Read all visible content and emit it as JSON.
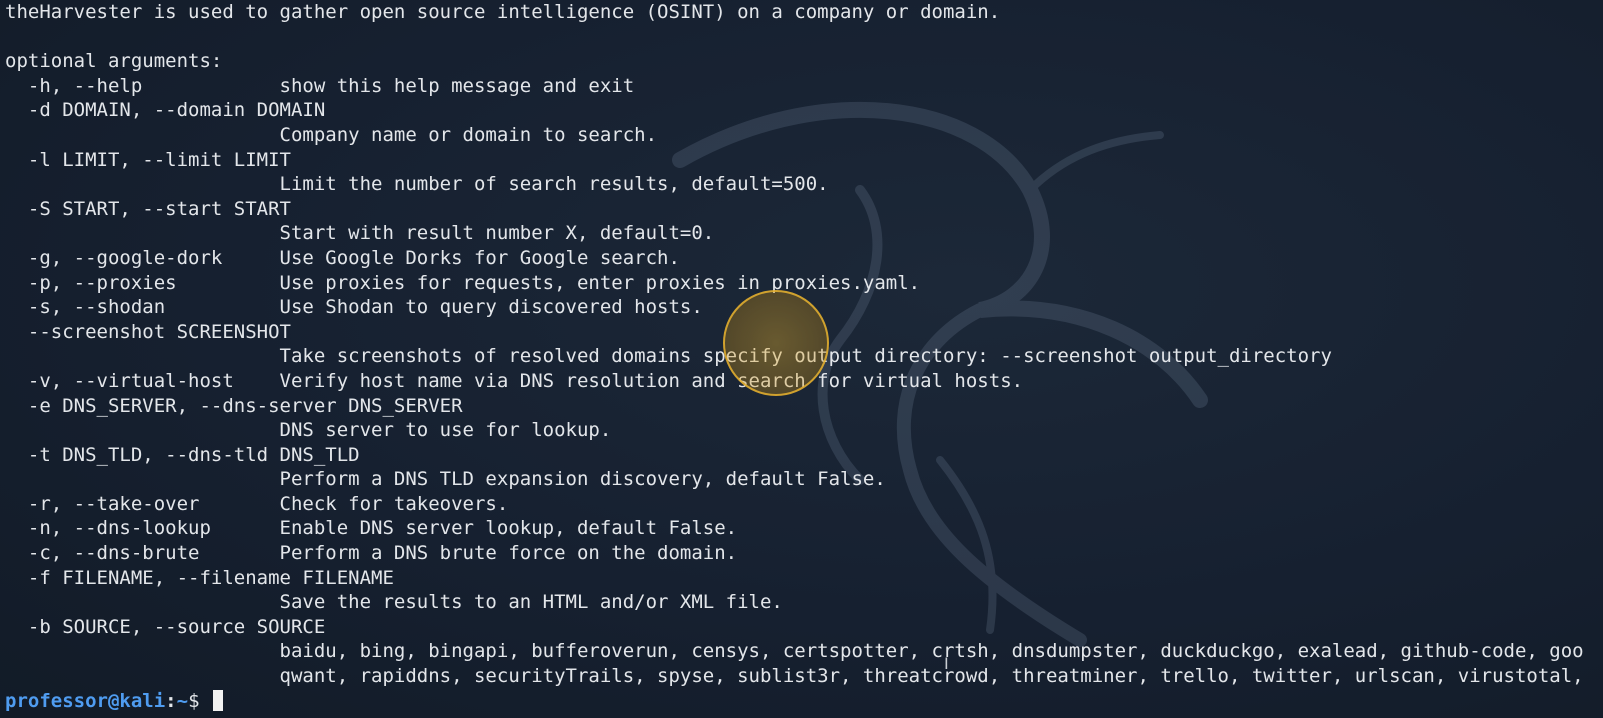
{
  "terminal": {
    "lines": [
      "theHarvester is used to gather open source intelligence (OSINT) on a company or domain.",
      "",
      "optional arguments:",
      "  -h, --help            show this help message and exit",
      "  -d DOMAIN, --domain DOMAIN",
      "                        Company name or domain to search.",
      "  -l LIMIT, --limit LIMIT",
      "                        Limit the number of search results, default=500.",
      "  -S START, --start START",
      "                        Start with result number X, default=0.",
      "  -g, --google-dork     Use Google Dorks for Google search.",
      "  -p, --proxies         Use proxies for requests, enter proxies in proxies.yaml.",
      "  -s, --shodan          Use Shodan to query discovered hosts.",
      "  --screenshot SCREENSHOT",
      "                        Take screenshots of resolved domains specify output directory: --screenshot output_directory",
      "  -v, --virtual-host    Verify host name via DNS resolution and search for virtual hosts.",
      "  -e DNS_SERVER, --dns-server DNS_SERVER",
      "                        DNS server to use for lookup.",
      "  -t DNS_TLD, --dns-tld DNS_TLD",
      "                        Perform a DNS TLD expansion discovery, default False.",
      "  -r, --take-over       Check for takeovers.",
      "  -n, --dns-lookup      Enable DNS server lookup, default False.",
      "  -c, --dns-brute       Perform a DNS brute force on the domain.",
      "  -f FILENAME, --filename FILENAME",
      "                        Save the results to an HTML and/or XML file.",
      "  -b SOURCE, --source SOURCE",
      "                        baidu, bing, bingapi, bufferoverun, censys, certspotter, crtsh, dnsdumpster, duckduckgo, exalead, github-code, goo",
      "                        qwant, rapiddns, securityTrails, spyse, sublist3r, threatcrowd, threatminer, trello, twitter, urlscan, virustotal,"
    ],
    "prompt": {
      "user_host": "professor@kali",
      "separator": ":",
      "path": "~",
      "symbol": "$ "
    },
    "colors": {
      "background": "#16202d",
      "text": "#e3e6ea",
      "prompt": "#4f9cf0",
      "click_indicator": "#e0aa28"
    },
    "watermark_icon": "kali-dragon-icon"
  }
}
